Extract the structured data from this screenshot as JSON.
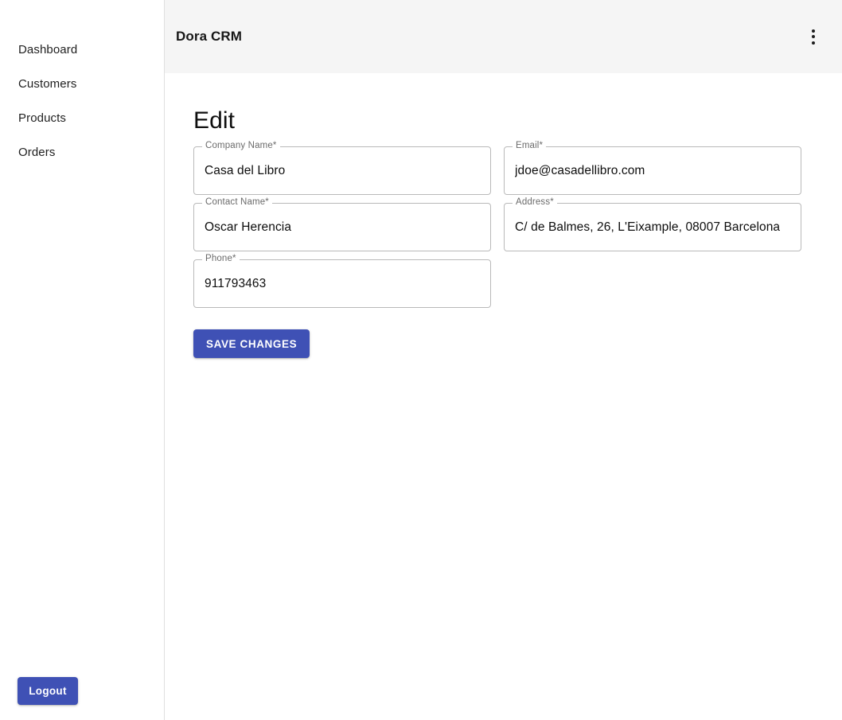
{
  "sidebar": {
    "items": [
      {
        "label": "Dashboard",
        "name": "dashboard"
      },
      {
        "label": "Customers",
        "name": "customers"
      },
      {
        "label": "Products",
        "name": "products"
      },
      {
        "label": "Orders",
        "name": "orders"
      }
    ],
    "logout_label": "Logout"
  },
  "header": {
    "title": "Dora CRM",
    "menu_icon": "kebab-menu-icon"
  },
  "main": {
    "page_title": "Edit",
    "save_label": "SAVE CHANGES",
    "fields": [
      {
        "label": "Company Name*",
        "value": "Casa del Libro",
        "placeholder": "",
        "name": "company-name"
      },
      {
        "label": "Email*",
        "value": "jdoe@casadellibro.com",
        "placeholder": "",
        "name": "email"
      },
      {
        "label": "Contact Name*",
        "value": "Oscar Herencia",
        "placeholder": "",
        "name": "contact-name"
      },
      {
        "label": "Address*",
        "value": "C/ de Balmes, 26, L'Eixample, 08007 Barcelona",
        "placeholder": "",
        "name": "address"
      },
      {
        "label": "Phone*",
        "value": "911793463",
        "placeholder": "",
        "name": "phone"
      }
    ]
  },
  "colors": {
    "accent": "#3f51b5",
    "topbar_background": "#f5f5f5",
    "field_border": "#b9b9b9",
    "label_text": "#6b6b6b"
  }
}
